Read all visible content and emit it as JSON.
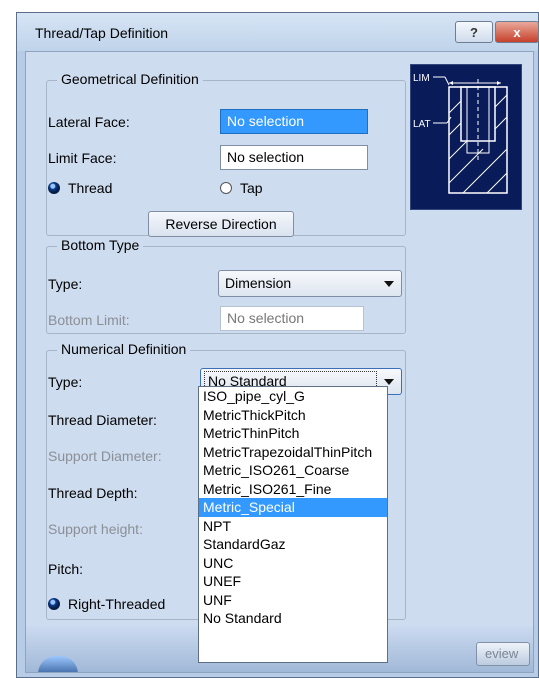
{
  "window": {
    "title": "Thread/Tap Definition",
    "help_label": "?",
    "close_label": "x"
  },
  "geometrical": {
    "title": "Geometrical Definition",
    "lateral_face_label": "Lateral Face:",
    "lateral_face_value": "No selection",
    "limit_face_label": "Limit Face:",
    "limit_face_value": "No selection",
    "thread_label": "Thread",
    "tap_label": "Tap",
    "reverse_label": "Reverse Direction",
    "preview_lim": "LIM",
    "preview_lat": "LAT"
  },
  "bottom_type": {
    "title": "Bottom Type",
    "type_label": "Type:",
    "type_value": "Dimension",
    "limit_label": "Bottom Limit:",
    "limit_value": "No selection"
  },
  "numerical": {
    "title": "Numerical Definition",
    "type_label": "Type:",
    "type_value": "No Standard",
    "thread_diameter_label": "Thread Diameter:",
    "support_diameter_label": "Support Diameter:",
    "thread_depth_label": "Thread Depth:",
    "support_height_label": "Support height:",
    "pitch_label": "Pitch:",
    "right_threaded_label": "Right-Threaded"
  },
  "dropdown": {
    "options": [
      "ISO_pipe_cyl_G",
      "MetricThickPitch",
      "MetricThinPitch",
      "MetricTrapezoidalThinPitch",
      "Metric_ISO261_Coarse",
      "Metric_ISO261_Fine",
      "Metric_Special",
      "NPT",
      "StandardGaz",
      "UNC",
      "UNEF",
      "UNF",
      "No Standard"
    ],
    "selected_index": 6
  },
  "footer": {
    "preview_label": "eview"
  }
}
